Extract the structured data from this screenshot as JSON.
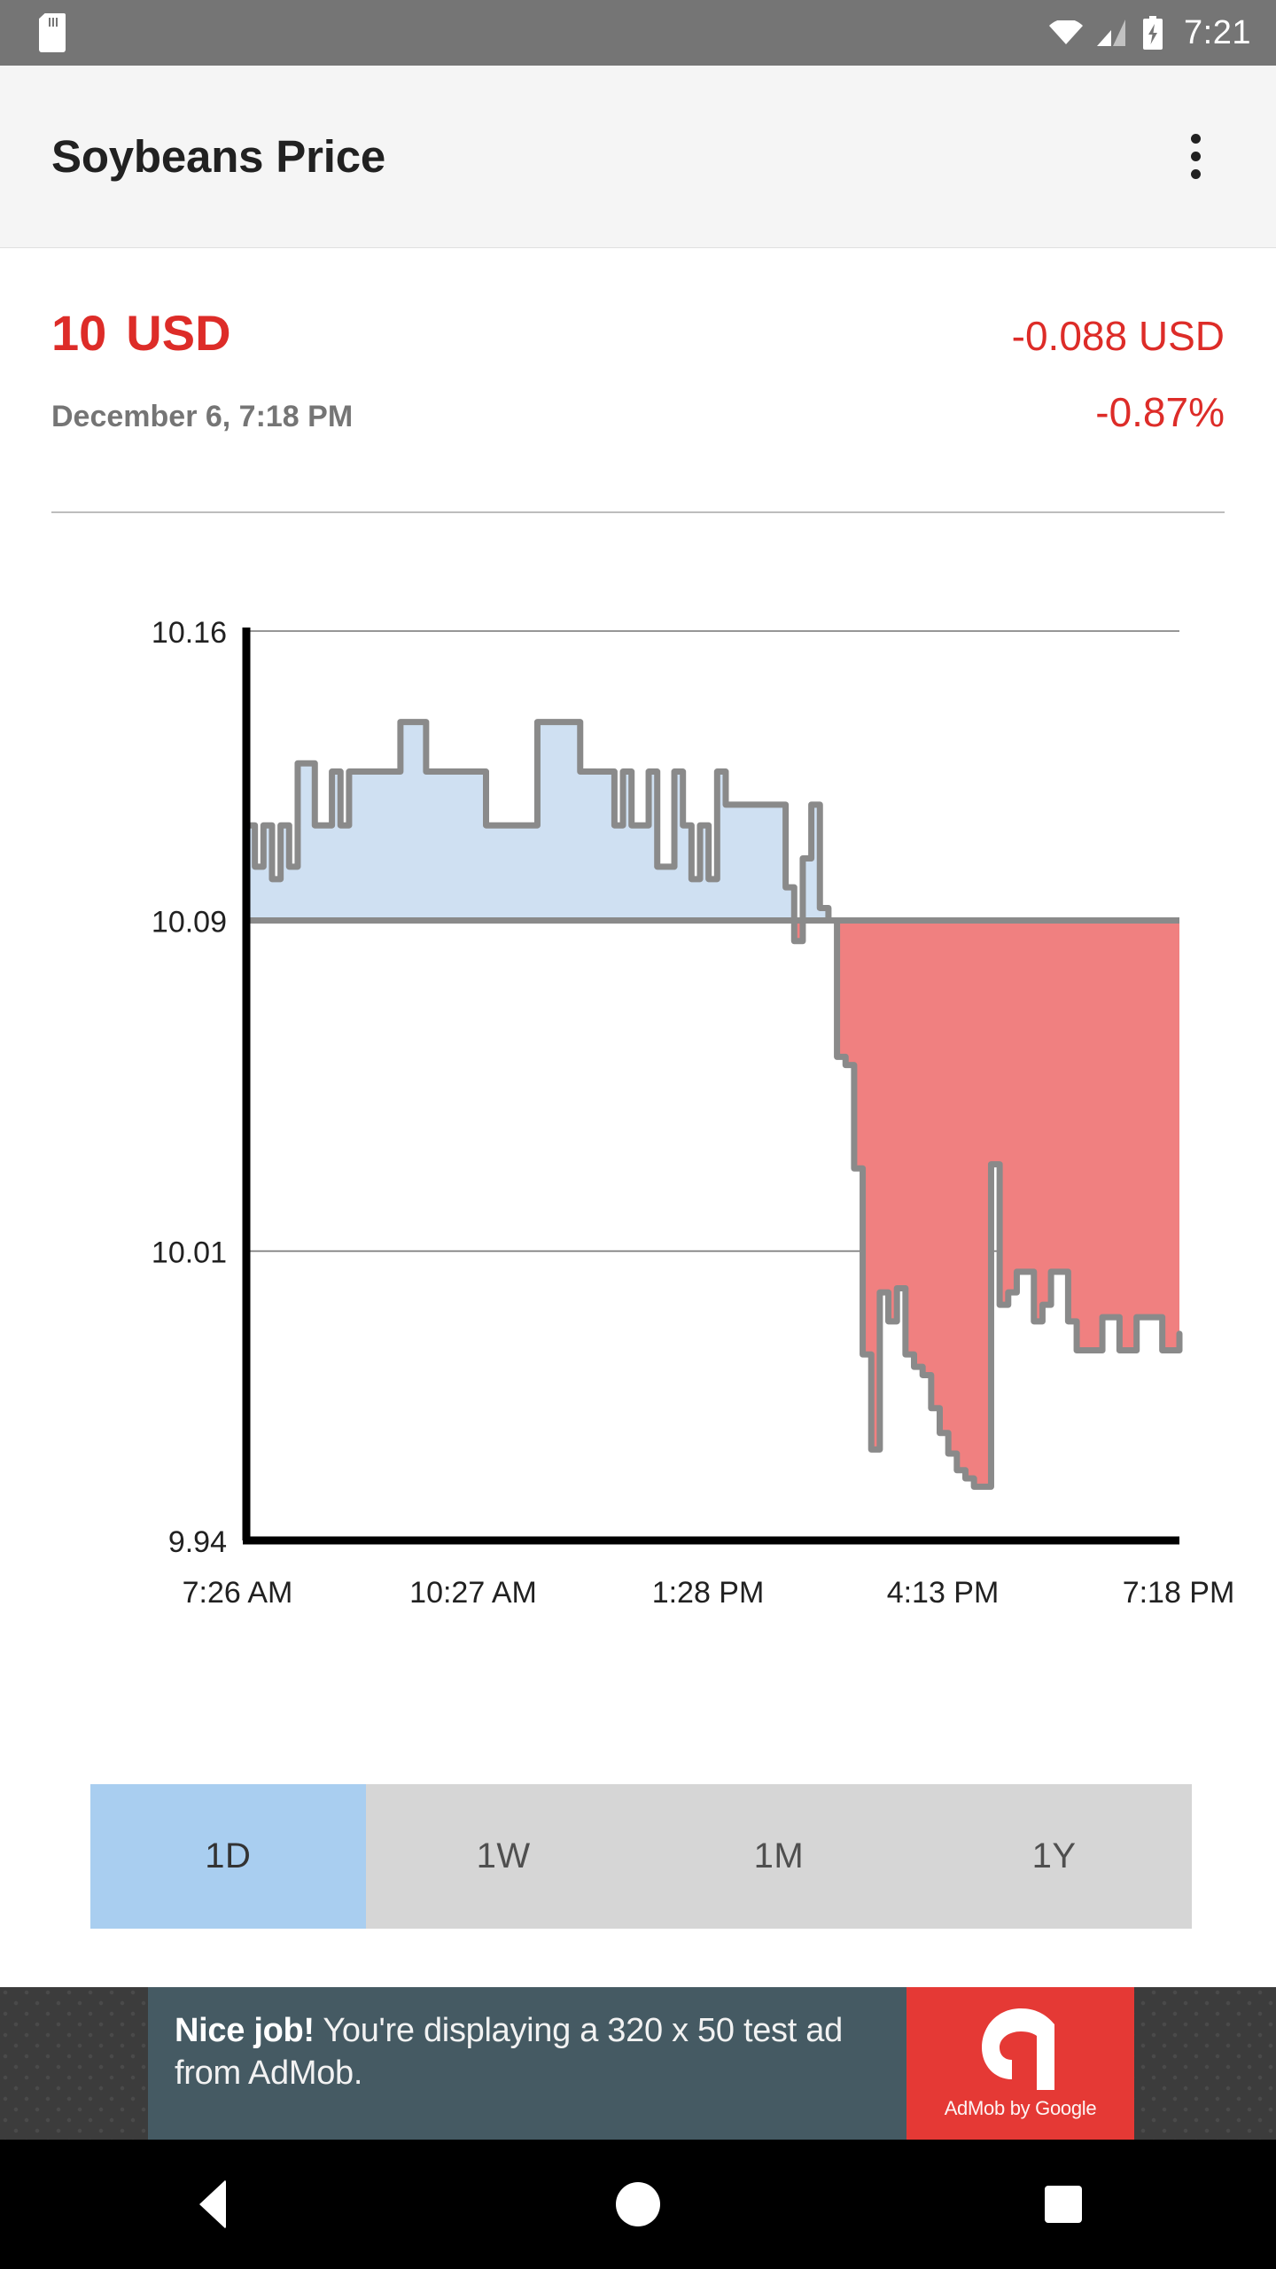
{
  "statusbar": {
    "time": "7:21",
    "icons": [
      "sdcard-icon",
      "wifi-icon",
      "cellular-signal-icon",
      "battery-charging-icon"
    ]
  },
  "appbar": {
    "title": "Soybeans Price",
    "overflow_label": "More options"
  },
  "quote": {
    "price_value": "10",
    "price_currency": "USD",
    "change_absolute": "-0.088 USD",
    "date": "December 6, 7:18 PM",
    "change_percent": "-0.87%",
    "negative_color": "#dd2c28",
    "date_color": "#757575"
  },
  "ranges": {
    "options": [
      "1D",
      "1W",
      "1M",
      "1Y"
    ],
    "selected": "1D",
    "selected_color": "#a9cef0",
    "track_color": "#d6d6d6"
  },
  "ad": {
    "headline": "Nice job!",
    "body": " You're displaying a 320 x 50 test ad from AdMob.",
    "brand": "AdMob by Google",
    "brand_color": "#e53935",
    "panel_color": "#455a63"
  },
  "navbar": {
    "buttons": [
      "back-button",
      "home-button",
      "recents-button"
    ]
  },
  "chart_data": {
    "type": "area",
    "title": "",
    "xlabel": "",
    "ylabel": "",
    "ylim": [
      9.94,
      10.16
    ],
    "yticks": [
      9.94,
      10.01,
      10.09,
      10.16
    ],
    "ytick_labels": [
      "9.94",
      "10.01",
      "10.09",
      "10.16"
    ],
    "xtick_labels": [
      "7:26 AM",
      "10:27 AM",
      "1:28 PM",
      "4:13 PM",
      "7:18 PM"
    ],
    "grid": true,
    "legend": "none",
    "baseline": 10.09,
    "line_color": "#8a8a8a",
    "fill_above_color": "#cfe0f2",
    "fill_below_color": "#f08080",
    "series": [
      {
        "name": "Soybeans Price",
        "step": true,
        "values": [
          10.113,
          10.103,
          10.113,
          10.1,
          10.113,
          10.103,
          10.128,
          10.128,
          10.113,
          10.113,
          10.126,
          10.113,
          10.126,
          10.126,
          10.126,
          10.126,
          10.126,
          10.126,
          10.138,
          10.138,
          10.138,
          10.126,
          10.126,
          10.126,
          10.126,
          10.126,
          10.126,
          10.126,
          10.113,
          10.113,
          10.113,
          10.113,
          10.113,
          10.113,
          10.138,
          10.138,
          10.138,
          10.138,
          10.138,
          10.126,
          10.126,
          10.126,
          10.126,
          10.113,
          10.126,
          10.113,
          10.113,
          10.126,
          10.103,
          10.103,
          10.126,
          10.113,
          10.1,
          10.113,
          10.1,
          10.126,
          10.118,
          10.118,
          10.118,
          10.118,
          10.118,
          10.118,
          10.118,
          10.098,
          10.085,
          10.105,
          10.118,
          10.093,
          10.09,
          10.057,
          10.055,
          10.03,
          9.985,
          9.962,
          10.0,
          9.993,
          10.001,
          9.985,
          9.982,
          9.98,
          9.972,
          9.966,
          9.961,
          9.957,
          9.955,
          9.953,
          9.953,
          10.031,
          9.997,
          10.0,
          10.005,
          10.005,
          9.993,
          9.997,
          10.005,
          10.005,
          9.993,
          9.986,
          9.986,
          9.986,
          9.994,
          9.994,
          9.986,
          9.986,
          9.994,
          9.994,
          9.994,
          9.986,
          9.986,
          9.99
        ]
      }
    ]
  }
}
